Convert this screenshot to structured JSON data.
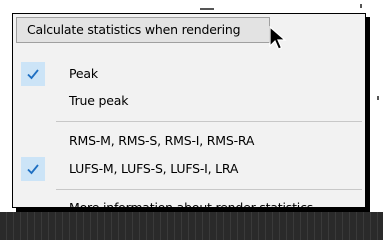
{
  "menu": {
    "header_label": "Calculate statistics when rendering",
    "items": [
      {
        "label": "Peak",
        "checked": true
      },
      {
        "label": "True peak",
        "checked": false
      },
      {
        "label": "RMS-M, RMS-S, RMS-I, RMS-RA",
        "checked": false
      },
      {
        "label": "LUFS-M, LUFS-S, LUFS-I, LRA",
        "checked": true
      },
      {
        "label": "More information about render statistics",
        "checked": false
      }
    ]
  },
  "colors": {
    "check_highlight": "#cce4f7",
    "check_mark": "#1e6fc2",
    "menu_background": "#f2f2f2"
  },
  "icons": {
    "check": "checkmark-icon",
    "cursor": "mouse-pointer-icon"
  }
}
